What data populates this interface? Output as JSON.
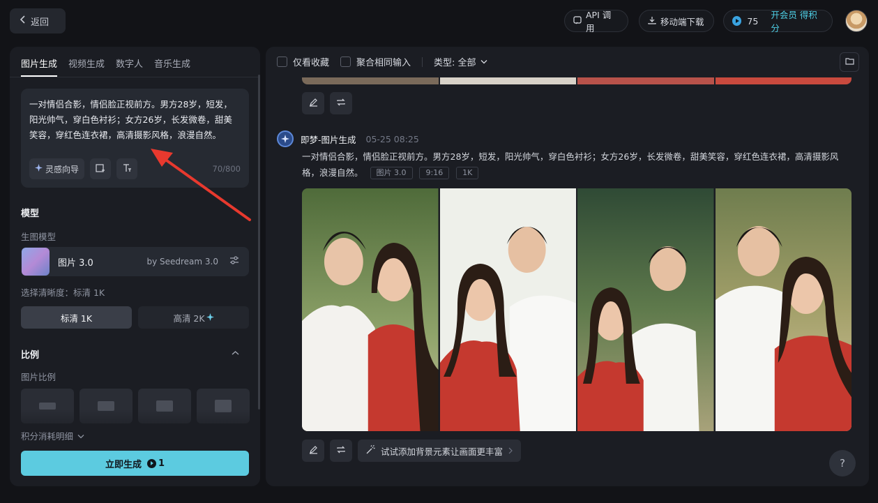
{
  "header": {
    "back_label": "返回",
    "api_label": "API 调用",
    "download_label": "移动端下载",
    "credits": "75",
    "vip_label": "开会员 得积分"
  },
  "left": {
    "tabs": [
      "图片生成",
      "视频生成",
      "数字人",
      "音乐生成"
    ],
    "prompt_text": "一对情侣合影，情侣脸正视前方。男方28岁，短发，阳光帅气，穿白色衬衫；女方26岁，长发微卷，甜美笑容，穿红色连衣裙，高清摄影风格，浪漫自然。",
    "inspire_label": "灵感向导",
    "char_count": "70/800",
    "model_section": "模型",
    "model_sublabel": "生图模型",
    "model_name": "图片 3.0",
    "model_by": "by Seedream 3.0",
    "resolution_label": "选择清晰度：标清 1K",
    "res_sd": "标清 1K",
    "res_hd": "高清 2K",
    "ratio_section": "比例",
    "ratio_sublabel": "图片比例",
    "credits_detail": "积分消耗明细",
    "generate_label": "立即生成",
    "generate_cost": "1"
  },
  "right": {
    "filter_fav": "仅看收藏",
    "filter_merge": "聚合相同输入",
    "filter_type": "类型: 全部",
    "gen_source": "即梦-图片生成",
    "gen_time": "05-25   08:25",
    "gen_prompt": "一对情侣合影，情侣脸正视前方。男方28岁，短发，阳光帅气，穿白色衬衫；女方26岁，长发微卷，甜美笑容，穿红色连衣裙，高清摄影风格，浪漫自然。",
    "tags": [
      "图片 3.0",
      "9:16",
      "1K"
    ],
    "suggest_label": "试试添加背景元素让画面更丰富",
    "help_label": "?"
  },
  "colors": {
    "accent": "#5ccbe0",
    "dress_red": "#c5392f",
    "panel": "#1b1d23"
  }
}
